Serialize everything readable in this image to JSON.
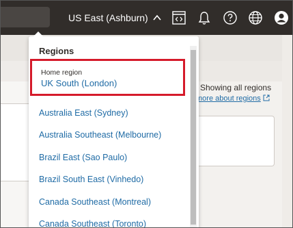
{
  "header": {
    "region_label": "US East (Ashburn)",
    "icons": [
      "cloud-shell-icon",
      "bell-icon",
      "help-icon",
      "globe-icon",
      "user-icon"
    ]
  },
  "background": {
    "showing_text": "Showing all regions",
    "learn_more": "more about regions"
  },
  "dropdown": {
    "title": "Regions",
    "home_region_label": "Home region",
    "home_region_value": "UK South (London)",
    "regions": [
      "Australia East (Sydney)",
      "Australia Southeast (Melbourne)",
      "Brazil East (Sao Paulo)",
      "Brazil South East (Vinhedo)",
      "Canada Southeast (Montreal)",
      "Canada Southeast (Toronto)"
    ]
  },
  "colors": {
    "header_bg": "#312d2a",
    "link": "#1f6ba5",
    "highlight_border": "#d51a2a"
  }
}
